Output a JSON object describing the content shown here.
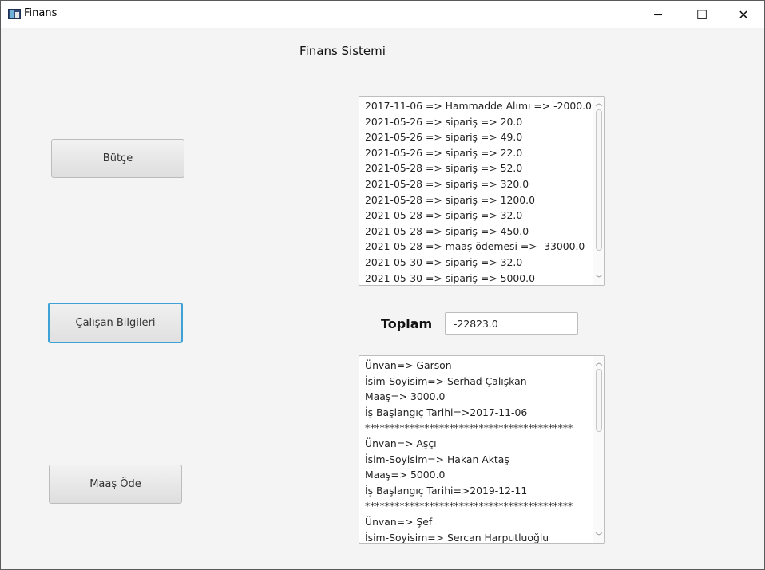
{
  "window": {
    "title": "Finans",
    "minimize_glyph": "─",
    "maximize_glyph": "☐",
    "close_glyph": "✕"
  },
  "heading": "Finans Sistemi",
  "buttons": {
    "butce": "Bütçe",
    "calisan": "Çalışan Bilgileri",
    "maas_ode": "Maaş Öde"
  },
  "transactions": [
    "2017-11-06 => Hammadde Alımı => -2000.0",
    "2021-05-26 => sipariş => 20.0",
    "2021-05-26 => sipariş => 49.0",
    "2021-05-26 => sipariş => 22.0",
    "2021-05-28 => sipariş => 52.0",
    "2021-05-28 => sipariş => 320.0",
    "2021-05-28 => sipariş => 1200.0",
    "2021-05-28 => sipariş => 32.0",
    "2021-05-28 => sipariş => 450.0",
    "2021-05-28 => maaş ödemesi => -33000.0",
    "2021-05-30 => sipariş => 32.0",
    "2021-05-30 => sipariş => 5000.0"
  ],
  "total": {
    "label": "Toplam",
    "value": "-22823.0"
  },
  "employees": [
    "Ünvan=> Garson",
    "İsim-Soyisim=> Serhad Çalışkan",
    "Maaş=> 3000.0",
    "İş Başlangıç Tarihi=>2017-11-06",
    "******************************************",
    "Ünvan=> Aşçı",
    "İsim-Soyisim=> Hakan Aktaş",
    "Maaş=> 5000.0",
    "İş Başlangıç Tarihi=>2019-12-11",
    "******************************************",
    "Ünvan=> Şef",
    "İsim-Soyisim=> Sercan Harputluoğlu"
  ],
  "scroll": {
    "up_glyph": "︿",
    "down_glyph": "﹀"
  }
}
